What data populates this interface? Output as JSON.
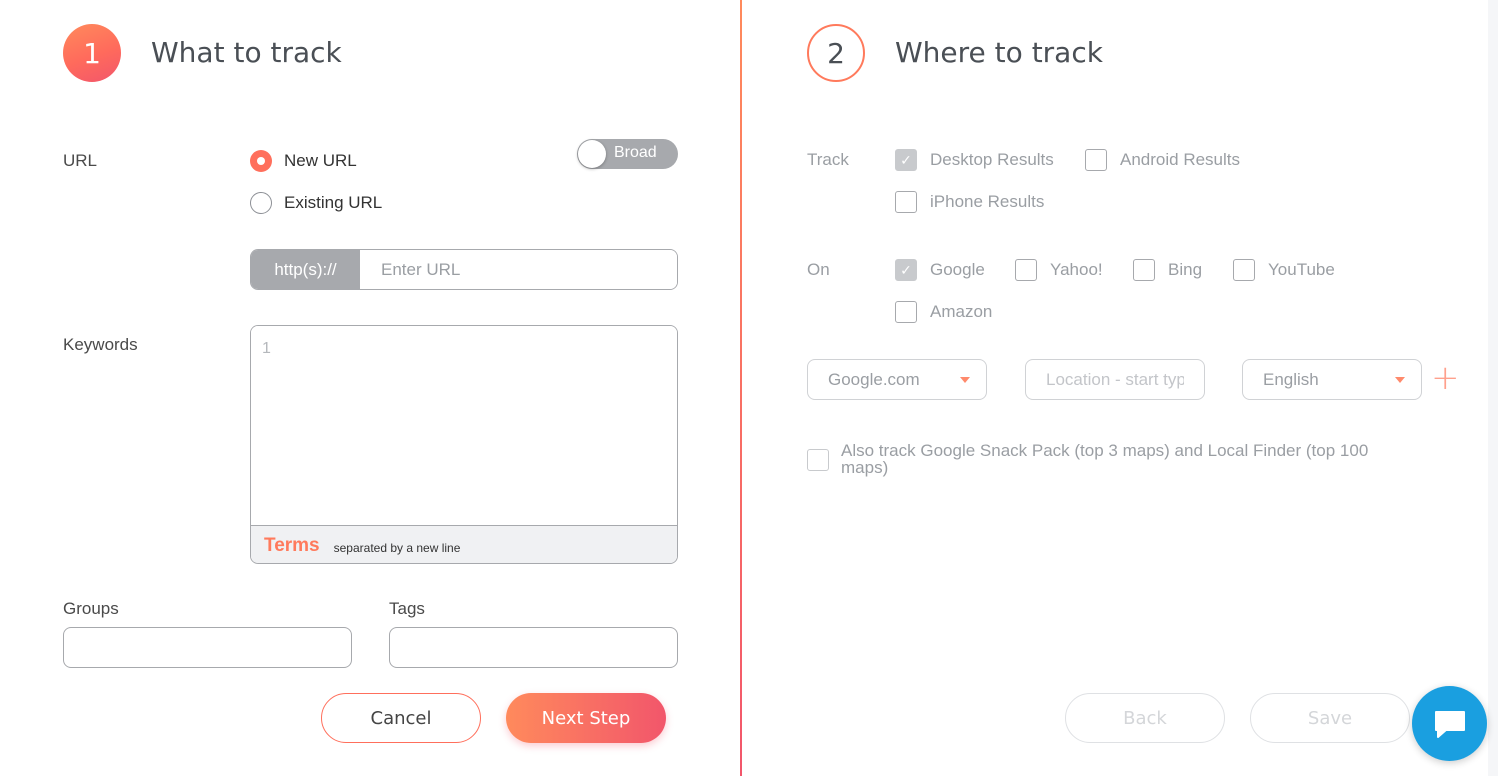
{
  "step1": {
    "number": "1",
    "title": "What to track",
    "url_label": "URL",
    "radio_new": "New URL",
    "radio_existing": "Existing URL",
    "selected": "New URL",
    "toggle_label": "Broad",
    "url_prefix": "http(s)://",
    "url_placeholder": "Enter URL",
    "keywords_label": "Keywords",
    "keywords_placeholder": "1",
    "terms_label": "Terms",
    "terms_hint": "separated by a new line",
    "groups_label": "Groups",
    "tags_label": "Tags",
    "cancel_label": "Cancel",
    "next_label": "Next Step"
  },
  "step2": {
    "number": "2",
    "title": "Where to track",
    "track_label": "Track",
    "track_options": [
      {
        "label": "Desktop Results",
        "checked": true
      },
      {
        "label": "Android Results",
        "checked": false
      },
      {
        "label": "iPhone Results",
        "checked": false
      }
    ],
    "on_label": "On",
    "engines": [
      {
        "label": "Google",
        "checked": true
      },
      {
        "label": "Yahoo!",
        "checked": false
      },
      {
        "label": "Bing",
        "checked": false
      },
      {
        "label": "YouTube",
        "checked": false
      },
      {
        "label": "Amazon",
        "checked": false
      }
    ],
    "domain_value": "Google.com",
    "location_placeholder": "Location - start typing",
    "language_value": "English",
    "snack_pack_label": "Also track Google Snack Pack (top 3 maps) and Local Finder (top 100 maps)",
    "snack_pack_checked": false,
    "back_label": "Back",
    "save_label": "Save"
  },
  "colors": {
    "accent": "#ff6f5c",
    "accent_gradient_end": "#f2566b",
    "chat": "#1a9fe0"
  }
}
